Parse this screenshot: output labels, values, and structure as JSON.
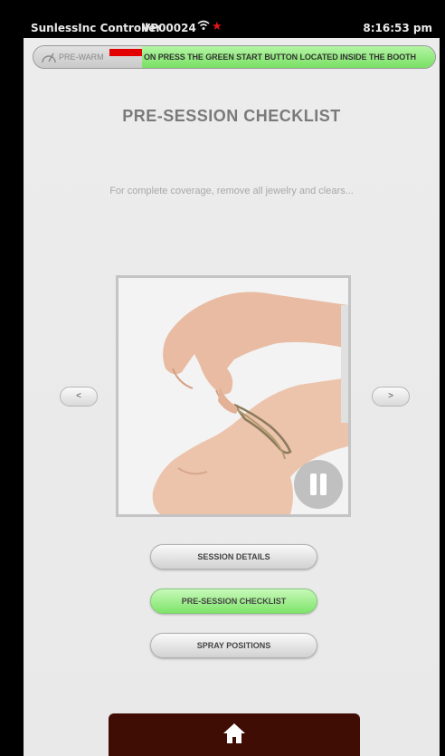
{
  "statusbar": {
    "app_title": "SunlessInc Controller",
    "device_id": "VP00024",
    "alert_glyph": "★",
    "time": "8:16:53 pm",
    "wifi_icon": "wifi-icon"
  },
  "prewarm": {
    "label": "PRE-WARM",
    "message": "ON PRESS THE GREEN START BUTTON LOCATED INSIDE THE BOOTH",
    "icon": "gauge-icon",
    "colors": {
      "red": "#e30000",
      "green": "#7fe46a"
    }
  },
  "page": {
    "title": "PRE-SESSION CHECKLIST",
    "caption": "For complete coverage, remove all jewelry and clears..."
  },
  "slideshow": {
    "prev_label": "<",
    "next_label": ">",
    "pause_icon": "pause-icon"
  },
  "menu": {
    "session_details": "SESSION DETAILS",
    "pre_session_checklist": "PRE-SESSION CHECKLIST",
    "spray_positions": "SPRAY POSITIONS",
    "active_color": "#7fe46a"
  },
  "footer": {
    "home_icon": "home-icon",
    "background": "#3f0d04"
  }
}
